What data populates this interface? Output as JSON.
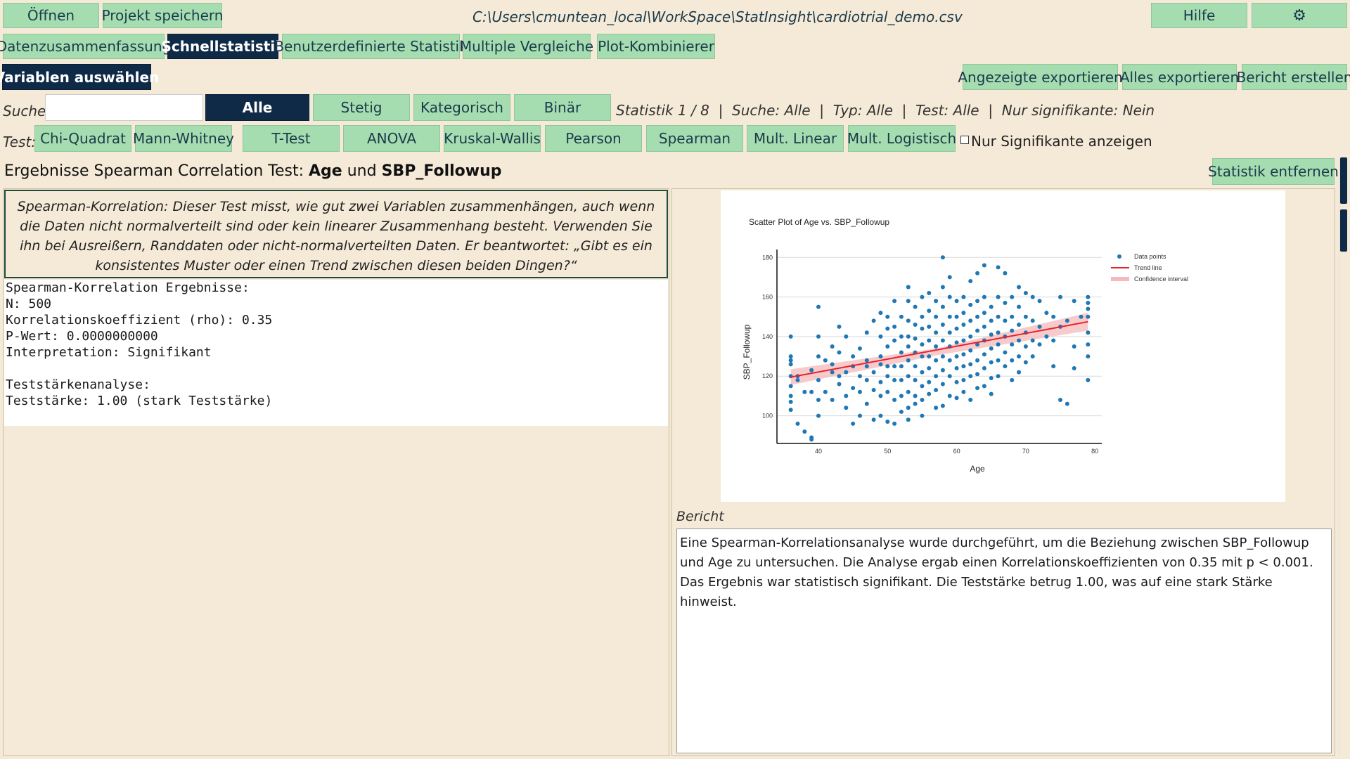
{
  "toolbar": {
    "open": "Öffnen",
    "save_project": "Projekt speichern",
    "file_path": "C:\\Users\\cmuntean_local\\WorkSpace\\StatInsight\\cardiotrial_demo.csv",
    "help": "Hilfe",
    "settings_icon": "gear-icon"
  },
  "tabs": [
    {
      "label": "Datenzusammenfassung"
    },
    {
      "label": "Schnellstatistik",
      "active": true
    },
    {
      "label": "Benutzerdefinierte Statistik"
    },
    {
      "label": "Multiple Vergleiche"
    },
    {
      "label": "Plot-Kombinierer"
    }
  ],
  "actions": {
    "select_variables": "Variablen auswählen",
    "export_shown": "Angezeigte exportieren",
    "export_all": "Alles exportieren",
    "create_report": "Bericht erstellen"
  },
  "filter": {
    "search_label": "Suche:",
    "search_value": "",
    "types": [
      "Alle",
      "Stetig",
      "Kategorisch",
      "Binär"
    ],
    "active_type": "Alle",
    "status": "Statistik 1 / 8  |  Suche: Alle  |  Typ: Alle  |  Test: Alle  |  Nur signifikante: Nein"
  },
  "tests": {
    "label": "Test:",
    "items": [
      "Chi-Quadrat",
      "Mann-Whitney",
      "T-Test",
      "ANOVA",
      "Kruskal-Wallis",
      "Pearson",
      "Spearman",
      "Mult. Linear",
      "Mult. Logistisch"
    ],
    "only_significant": "Nur Signifikante anzeigen",
    "only_significant_checked": false
  },
  "result_header": {
    "prefix": "Ergebnisse Spearman Correlation Test: ",
    "var1": "Age",
    "joiner": " und ",
    "var2": "SBP_Followup",
    "remove": "Statistik entfernen"
  },
  "description": "Spearman-Korrelation: Dieser Test misst, wie gut zwei Variablen zusammenhängen, auch wenn die Daten nicht normalverteilt sind oder kein linearer Zusammenhang besteht. Verwenden Sie ihn bei Ausreißern, Randdaten oder nicht-normalverteilten Daten. Er beantwortet: „Gibt es ein konsistentes Muster oder einen Trend zwischen diesen beiden Dingen?“",
  "results_text": "Spearman-Korrelation Ergebnisse:\nN: 500\nKorrelationskoeffizient (rho): 0.35\nP-Wert: 0.0000000000\nInterpretation: Signifikant\n\nTeststärkenanalyse:\nTeststärke: 1.00 (stark Teststärke)",
  "report": {
    "label": "Bericht",
    "text": "Eine Spearman-Korrelationsanalyse wurde durchgeführt, um die Beziehung zwischen SBP_Followup und Age zu untersuchen. Die Analyse ergab einen Korrelationskoeffizienten von 0.35 mit p < 0.001. Das Ergebnis war statistisch signifikant. Die Teststärke betrug 1.00, was auf eine stark Stärke hinweist."
  },
  "chart_data": {
    "type": "scatter",
    "title": "Scatter Plot of Age vs. SBP_Followup",
    "xlabel": "Age",
    "ylabel": "SBP_Followup",
    "xlim": [
      34,
      81
    ],
    "ylim": [
      86,
      184
    ],
    "xticks": [
      40,
      50,
      60,
      70,
      80
    ],
    "yticks": [
      100,
      120,
      140,
      160,
      180
    ],
    "grid": "horizontal",
    "legend": [
      "Data points",
      "Trend line",
      "Confidence interval"
    ],
    "legend_position": "right",
    "colors": {
      "points": "#1f77b4",
      "trend": "#e8202a",
      "ci": "#f4b9bb"
    },
    "trend": {
      "x": [
        36,
        79
      ],
      "y": [
        119.5,
        147.5
      ]
    },
    "ci_band": {
      "x": [
        36,
        57,
        79
      ],
      "lower": [
        115.5,
        130.5,
        143
      ],
      "upper": [
        123.5,
        134,
        152
      ]
    },
    "points": [
      [
        36,
        140
      ],
      [
        36,
        130
      ],
      [
        36,
        128
      ],
      [
        36,
        126
      ],
      [
        36,
        120
      ],
      [
        36,
        115
      ],
      [
        36,
        110
      ],
      [
        36,
        107
      ],
      [
        36,
        103
      ],
      [
        37,
        96
      ],
      [
        37,
        120
      ],
      [
        37,
        118
      ],
      [
        38,
        92
      ],
      [
        39,
        89
      ],
      [
        39,
        88
      ],
      [
        38,
        112
      ],
      [
        39,
        123
      ],
      [
        39,
        112
      ],
      [
        40,
        140
      ],
      [
        40,
        130
      ],
      [
        40,
        118
      ],
      [
        40,
        108
      ],
      [
        40,
        100
      ],
      [
        40,
        155
      ],
      [
        41,
        112
      ],
      [
        41,
        128
      ],
      [
        42,
        108
      ],
      [
        42,
        122
      ],
      [
        42,
        126
      ],
      [
        42,
        135
      ],
      [
        43,
        120
      ],
      [
        43,
        132
      ],
      [
        43,
        145
      ],
      [
        43,
        116
      ],
      [
        44,
        122
      ],
      [
        44,
        110
      ],
      [
        44,
        140
      ],
      [
        44,
        104
      ],
      [
        45,
        96
      ],
      [
        45,
        125
      ],
      [
        45,
        114
      ],
      [
        45,
        130
      ],
      [
        46,
        134
      ],
      [
        46,
        120
      ],
      [
        46,
        112
      ],
      [
        46,
        100
      ],
      [
        47,
        142
      ],
      [
        47,
        128
      ],
      [
        47,
        125
      ],
      [
        47,
        118
      ],
      [
        47,
        106
      ],
      [
        48,
        148
      ],
      [
        48,
        122
      ],
      [
        48,
        113
      ],
      [
        48,
        98
      ],
      [
        49,
        152
      ],
      [
        49,
        140
      ],
      [
        49,
        130
      ],
      [
        49,
        126
      ],
      [
        49,
        117
      ],
      [
        49,
        110
      ],
      [
        49,
        100
      ],
      [
        50,
        150
      ],
      [
        50,
        144
      ],
      [
        50,
        135
      ],
      [
        50,
        125
      ],
      [
        50,
        120
      ],
      [
        50,
        112
      ],
      [
        50,
        97
      ],
      [
        51,
        158
      ],
      [
        51,
        145
      ],
      [
        51,
        138
      ],
      [
        51,
        125
      ],
      [
        51,
        118
      ],
      [
        51,
        108
      ],
      [
        51,
        96
      ],
      [
        52,
        150
      ],
      [
        52,
        140
      ],
      [
        52,
        132
      ],
      [
        52,
        125
      ],
      [
        52,
        118
      ],
      [
        52,
        110
      ],
      [
        52,
        102
      ],
      [
        53,
        165
      ],
      [
        53,
        158
      ],
      [
        53,
        148
      ],
      [
        53,
        140
      ],
      [
        53,
        135
      ],
      [
        53,
        128
      ],
      [
        53,
        120
      ],
      [
        53,
        112
      ],
      [
        53,
        104
      ],
      [
        53,
        98
      ],
      [
        54,
        155
      ],
      [
        54,
        146
      ],
      [
        54,
        139
      ],
      [
        54,
        132
      ],
      [
        54,
        125
      ],
      [
        54,
        118
      ],
      [
        54,
        110
      ],
      [
        54,
        106
      ],
      [
        55,
        160
      ],
      [
        55,
        150
      ],
      [
        55,
        144
      ],
      [
        55,
        136
      ],
      [
        55,
        130
      ],
      [
        55,
        122
      ],
      [
        55,
        115
      ],
      [
        55,
        108
      ],
      [
        55,
        100
      ],
      [
        56,
        162
      ],
      [
        56,
        153
      ],
      [
        56,
        145
      ],
      [
        56,
        138
      ],
      [
        56,
        130
      ],
      [
        56,
        124
      ],
      [
        56,
        117
      ],
      [
        56,
        111
      ],
      [
        57,
        158
      ],
      [
        57,
        150
      ],
      [
        57,
        142
      ],
      [
        57,
        135
      ],
      [
        57,
        128
      ],
      [
        57,
        120
      ],
      [
        57,
        113
      ],
      [
        57,
        104
      ],
      [
        58,
        180
      ],
      [
        58,
        165
      ],
      [
        58,
        155
      ],
      [
        58,
        146
      ],
      [
        58,
        138
      ],
      [
        58,
        130
      ],
      [
        58,
        123
      ],
      [
        58,
        116
      ],
      [
        58,
        105
      ],
      [
        59,
        170
      ],
      [
        59,
        160
      ],
      [
        59,
        150
      ],
      [
        59,
        142
      ],
      [
        59,
        135
      ],
      [
        59,
        128
      ],
      [
        59,
        120
      ],
      [
        59,
        110
      ],
      [
        60,
        158
      ],
      [
        60,
        150
      ],
      [
        60,
        144
      ],
      [
        60,
        137
      ],
      [
        60,
        130
      ],
      [
        60,
        124
      ],
      [
        60,
        117
      ],
      [
        60,
        109
      ],
      [
        61,
        160
      ],
      [
        61,
        152
      ],
      [
        61,
        146
      ],
      [
        61,
        138
      ],
      [
        61,
        131
      ],
      [
        61,
        125
      ],
      [
        61,
        118
      ],
      [
        61,
        112
      ],
      [
        62,
        168
      ],
      [
        62,
        156
      ],
      [
        62,
        148
      ],
      [
        62,
        140
      ],
      [
        62,
        133
      ],
      [
        62,
        126
      ],
      [
        62,
        120
      ],
      [
        62,
        108
      ],
      [
        63,
        172
      ],
      [
        63,
        158
      ],
      [
        63,
        150
      ],
      [
        63,
        143
      ],
      [
        63,
        136
      ],
      [
        63,
        128
      ],
      [
        63,
        121
      ],
      [
        63,
        114
      ],
      [
        64,
        176
      ],
      [
        64,
        160
      ],
      [
        64,
        152
      ],
      [
        64,
        145
      ],
      [
        64,
        138
      ],
      [
        64,
        131
      ],
      [
        64,
        124
      ],
      [
        64,
        115
      ],
      [
        65,
        155
      ],
      [
        65,
        148
      ],
      [
        65,
        141
      ],
      [
        65,
        134
      ],
      [
        65,
        127
      ],
      [
        65,
        119
      ],
      [
        65,
        111
      ],
      [
        66,
        175
      ],
      [
        66,
        160
      ],
      [
        66,
        150
      ],
      [
        66,
        142
      ],
      [
        66,
        136
      ],
      [
        66,
        128
      ],
      [
        66,
        120
      ],
      [
        67,
        172
      ],
      [
        67,
        157
      ],
      [
        67,
        148
      ],
      [
        67,
        140
      ],
      [
        67,
        132
      ],
      [
        67,
        125
      ],
      [
        68,
        160
      ],
      [
        68,
        150
      ],
      [
        68,
        143
      ],
      [
        68,
        136
      ],
      [
        68,
        128
      ],
      [
        68,
        118
      ],
      [
        69,
        165
      ],
      [
        69,
        155
      ],
      [
        69,
        146
      ],
      [
        69,
        138
      ],
      [
        69,
        130
      ],
      [
        69,
        122
      ],
      [
        70,
        162
      ],
      [
        70,
        150
      ],
      [
        70,
        142
      ],
      [
        70,
        135
      ],
      [
        70,
        127
      ],
      [
        71,
        160
      ],
      [
        71,
        148
      ],
      [
        71,
        138
      ],
      [
        71,
        130
      ],
      [
        72,
        158
      ],
      [
        72,
        145
      ],
      [
        72,
        136
      ],
      [
        73,
        152
      ],
      [
        73,
        140
      ],
      [
        74,
        150
      ],
      [
        74,
        138
      ],
      [
        74,
        125
      ],
      [
        75,
        160
      ],
      [
        75,
        145
      ],
      [
        75,
        108
      ],
      [
        76,
        148
      ],
      [
        76,
        106
      ],
      [
        77,
        158
      ],
      [
        77,
        135
      ],
      [
        77,
        124
      ],
      [
        78,
        150
      ],
      [
        79,
        160
      ],
      [
        79,
        157
      ],
      [
        79,
        154
      ],
      [
        79,
        150
      ],
      [
        79,
        142
      ],
      [
        79,
        136
      ],
      [
        79,
        130
      ],
      [
        79,
        118
      ]
    ]
  }
}
